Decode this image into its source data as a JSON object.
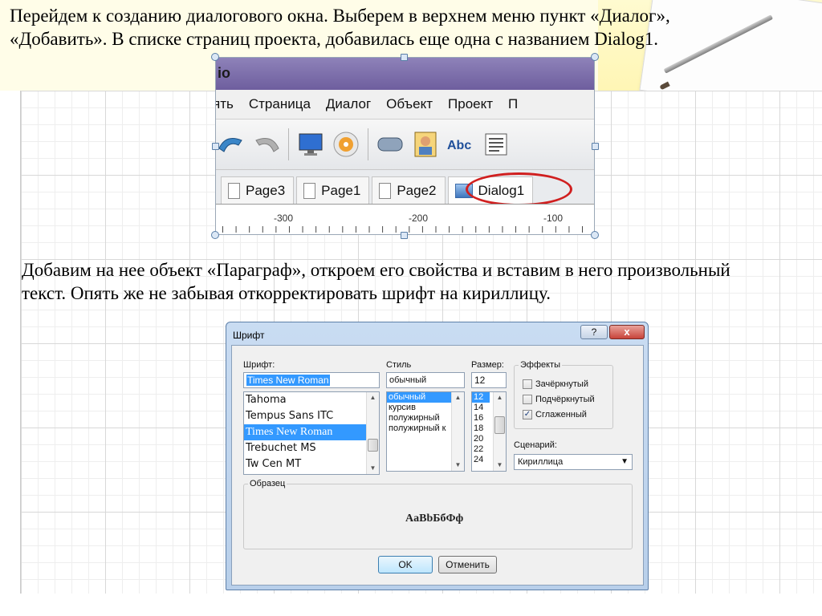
{
  "slide": {
    "paragraph1": "Перейдем к созданию диалогового окна. Выберем в верхнем меню пункт «Диалог», «Добавить». В списке страниц проекта, добавилась еще одна с названием Dialog1.",
    "paragraph2": "Добавим на нее объект «Параграф», откроем его свойства и вставим в него произвольный текст. Опять же не забывая откорректировать шрифт на кириллицу."
  },
  "screenshot1": {
    "title_fragment": "io",
    "menu": [
      "ять",
      "Страница",
      "Диалог",
      "Объект",
      "Проект",
      "П"
    ],
    "tabs": [
      "Page3",
      "Page1",
      "Page2",
      "Dialog1"
    ],
    "ruler_labels": [
      "-300",
      "-200",
      "-100"
    ],
    "highlight_color": "#d01f1f"
  },
  "font_dialog": {
    "title": "Шрифт",
    "help_label": "?",
    "close_label": "x",
    "font_label": "Шрифт:",
    "font_value": "Times New Roman",
    "font_list": [
      "Tahoma",
      "Tempus Sans ITC",
      "Times New Roman",
      "Trebuchet MS",
      "Tw Cen MT"
    ],
    "font_selected": "Times New Roman",
    "style_label": "Стиль",
    "style_value": "обычный",
    "style_list": [
      "обычный",
      "курсив",
      "полужирный",
      "полужирный к"
    ],
    "style_selected": "обычный",
    "size_label": "Размер:",
    "size_value": "12",
    "size_list": [
      "12",
      "14",
      "16",
      "18",
      "20",
      "22",
      "24"
    ],
    "size_selected": "12",
    "effects_label": "Эффекты",
    "effects": [
      {
        "label": "Зачёркнутый",
        "checked": false
      },
      {
        "label": "Подчёркнутый",
        "checked": false
      },
      {
        "label": "Сглаженный",
        "checked": true
      }
    ],
    "script_label": "Сценарий:",
    "script_value": "Кириллица",
    "sample_label": "Образец",
    "sample_text": "AaBbБбФф",
    "ok_label": "OK",
    "cancel_label": "Отменить"
  }
}
